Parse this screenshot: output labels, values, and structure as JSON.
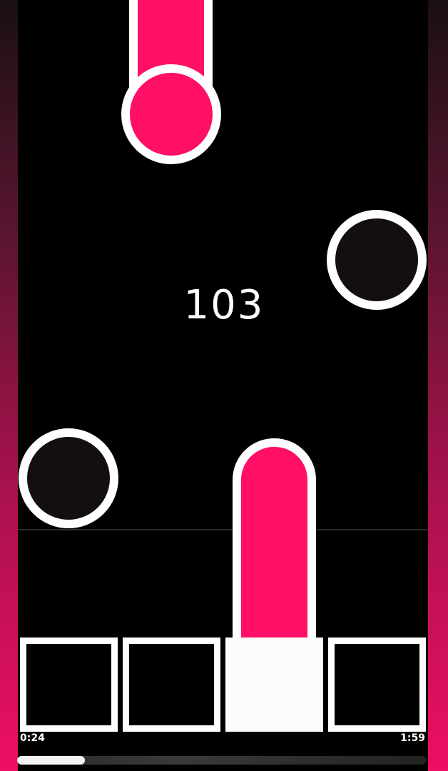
{
  "game": {
    "score": "103",
    "playback": {
      "elapsed": "0:24",
      "total": "1:59",
      "progress": 0.165
    },
    "lanes": 4,
    "active_key": 3,
    "colors": {
      "note_hold": "#ff0f66",
      "note_tap": "#140f0f",
      "outline": "#ffffff",
      "side_gradient_bottom": "#ee0f62"
    }
  }
}
